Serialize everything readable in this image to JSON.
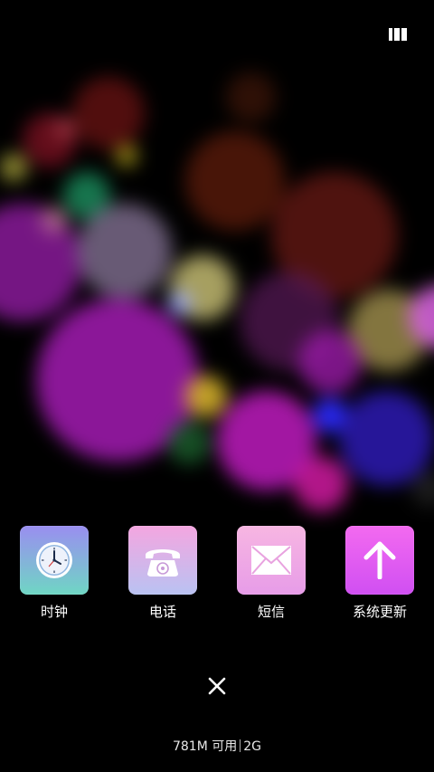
{
  "colors": {
    "background": "#000000",
    "clock_tile_top": "#9a8ef0",
    "clock_tile_bottom": "#6fd6c4",
    "phone_tile_top": "#f4a6e0",
    "phone_tile_bottom": "#b9c2f2",
    "sms_tile_top": "#f7b6e2",
    "sms_tile_bottom": "#e79ce8",
    "update_tile_top": "#f36af0",
    "update_tile_bottom": "#d04ff2"
  },
  "apps": [
    {
      "label": "时钟",
      "icon": "clock-icon"
    },
    {
      "label": "电话",
      "icon": "phone-icon"
    },
    {
      "label": "短信",
      "icon": "envelope-icon"
    },
    {
      "label": "系统更新",
      "icon": "arrow-up-icon"
    }
  ],
  "footer": {
    "memory_free": "781M 可用",
    "memory_total": "2G"
  },
  "controls": {
    "close_icon": "close-icon",
    "top_right_icon": "multi-window-icon"
  }
}
